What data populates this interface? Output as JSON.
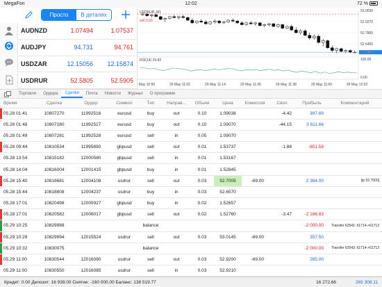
{
  "status": {
    "carrier": "MegaFon",
    "time": "12:02",
    "battery": "72 %"
  },
  "segment": {
    "simple": "Просто",
    "details": "В деталях"
  },
  "quotes": [
    {
      "symbol": "AUDNZD",
      "bid": "1.07494",
      "ask": "1.07537"
    },
    {
      "symbol": "AUDJPY",
      "bid": "94.731",
      "ask": "94.761"
    },
    {
      "symbol": "USDZAR",
      "bid": "12.15056",
      "ask": "12.15874"
    },
    {
      "symbol": "USDRUR",
      "bid": "52.5805",
      "ask": "52.5905"
    }
  ],
  "chart": {
    "title": "USDRUR, M1",
    "sell_label": "sell 0.03",
    "indicator_label": "RSI(14) 29.82",
    "y_ticks": [
      "53.0630",
      "52.9270",
      "52.7865",
      "52.6465",
      "52.5805",
      "52.5055"
    ],
    "rsi_ticks": [
      "100.00",
      "0.00"
    ],
    "x_ticks": [
      "29 May 10:50",
      "29 May 11:02",
      "29 May 11:14",
      "29 May 11:26",
      "29 May 11:38",
      "29 May 11:50",
      "29 May 12:02"
    ],
    "candles": [
      {
        "o": 53.0,
        "h": 53.03,
        "l": 52.99,
        "c": 53.01
      },
      {
        "o": 53.01,
        "h": 53.02,
        "l": 52.98,
        "c": 52.99
      },
      {
        "o": 52.99,
        "h": 53.01,
        "l": 52.97,
        "c": 53.0
      },
      {
        "o": 53.0,
        "h": 53.02,
        "l": 52.98,
        "c": 52.98
      },
      {
        "o": 52.98,
        "h": 52.99,
        "l": 52.94,
        "c": 52.95
      },
      {
        "o": 52.95,
        "h": 52.97,
        "l": 52.92,
        "c": 52.96
      },
      {
        "o": 52.96,
        "h": 52.99,
        "l": 52.95,
        "c": 52.98
      },
      {
        "o": 52.98,
        "h": 53.0,
        "l": 52.96,
        "c": 52.97
      },
      {
        "o": 52.97,
        "h": 52.99,
        "l": 52.95,
        "c": 52.98
      },
      {
        "o": 52.98,
        "h": 53.0,
        "l": 52.96,
        "c": 52.97
      },
      {
        "o": 52.97,
        "h": 52.98,
        "l": 52.93,
        "c": 52.94
      },
      {
        "o": 52.94,
        "h": 52.96,
        "l": 52.9,
        "c": 52.91
      },
      {
        "o": 52.91,
        "h": 52.94,
        "l": 52.9,
        "c": 52.93
      },
      {
        "o": 52.93,
        "h": 52.95,
        "l": 52.91,
        "c": 52.92
      },
      {
        "o": 52.92,
        "h": 52.94,
        "l": 52.89,
        "c": 52.9
      },
      {
        "o": 52.9,
        "h": 52.93,
        "l": 52.89,
        "c": 52.92
      },
      {
        "o": 52.92,
        "h": 52.95,
        "l": 52.9,
        "c": 52.93
      },
      {
        "o": 52.93,
        "h": 52.94,
        "l": 52.9,
        "c": 52.91
      },
      {
        "o": 52.91,
        "h": 52.93,
        "l": 52.9,
        "c": 52.92
      },
      {
        "o": 52.92,
        "h": 52.95,
        "l": 52.91,
        "c": 52.94
      },
      {
        "o": 52.94,
        "h": 52.96,
        "l": 52.92,
        "c": 52.93
      },
      {
        "o": 52.93,
        "h": 52.94,
        "l": 52.9,
        "c": 52.91
      },
      {
        "o": 52.91,
        "h": 52.93,
        "l": 52.88,
        "c": 52.89
      },
      {
        "o": 52.89,
        "h": 52.92,
        "l": 52.88,
        "c": 52.91
      },
      {
        "o": 52.91,
        "h": 52.93,
        "l": 52.89,
        "c": 52.9
      },
      {
        "o": 52.9,
        "h": 52.92,
        "l": 52.88,
        "c": 52.91
      },
      {
        "o": 52.91,
        "h": 52.92,
        "l": 52.87,
        "c": 52.88
      },
      {
        "o": 52.88,
        "h": 52.9,
        "l": 52.86,
        "c": 52.89
      },
      {
        "o": 52.89,
        "h": 52.91,
        "l": 52.87,
        "c": 52.9
      },
      {
        "o": 52.9,
        "h": 52.91,
        "l": 52.86,
        "c": 52.87
      },
      {
        "o": 52.87,
        "h": 52.9,
        "l": 52.86,
        "c": 52.89
      },
      {
        "o": 52.89,
        "h": 52.9,
        "l": 52.84,
        "c": 52.85
      },
      {
        "o": 52.85,
        "h": 52.88,
        "l": 52.84,
        "c": 52.87
      },
      {
        "o": 52.87,
        "h": 52.89,
        "l": 52.82,
        "c": 52.83
      },
      {
        "o": 52.83,
        "h": 52.86,
        "l": 52.79,
        "c": 52.8
      },
      {
        "o": 52.8,
        "h": 52.84,
        "l": 52.78,
        "c": 52.82
      },
      {
        "o": 52.82,
        "h": 52.84,
        "l": 52.76,
        "c": 52.77
      },
      {
        "o": 52.77,
        "h": 52.8,
        "l": 52.72,
        "c": 52.74
      },
      {
        "o": 52.74,
        "h": 52.78,
        "l": 52.72,
        "c": 52.76
      },
      {
        "o": 52.76,
        "h": 52.78,
        "l": 52.68,
        "c": 52.69
      },
      {
        "o": 52.69,
        "h": 52.73,
        "l": 52.65,
        "c": 52.71
      },
      {
        "o": 52.71,
        "h": 52.72,
        "l": 52.62,
        "c": 52.63
      },
      {
        "o": 52.63,
        "h": 52.66,
        "l": 52.58,
        "c": 52.6
      },
      {
        "o": 52.6,
        "h": 52.63,
        "l": 52.57,
        "c": 52.62
      },
      {
        "o": 52.62,
        "h": 52.63,
        "l": 52.58,
        "c": 52.59
      },
      {
        "o": 52.59,
        "h": 52.61,
        "l": 52.57,
        "c": 52.6
      },
      {
        "o": 52.6,
        "h": 52.61,
        "l": 52.57,
        "c": 52.58
      },
      {
        "o": 52.58,
        "h": 52.6,
        "l": 52.57,
        "c": 52.58
      }
    ],
    "rsi": [
      55,
      52,
      48,
      50,
      44,
      40,
      46,
      52,
      50,
      48,
      44,
      38,
      42,
      45,
      40,
      43,
      47,
      44,
      46,
      50,
      48,
      43,
      39,
      44,
      42,
      45,
      40,
      43,
      46,
      41,
      44,
      38,
      42,
      36,
      32,
      38,
      34,
      30,
      36,
      28,
      33,
      27,
      30,
      34,
      31,
      33,
      30,
      29
    ]
  },
  "tabs": [
    "Торговля",
    "Ордера",
    "Сделки",
    "Почта",
    "Новости",
    "Журнал",
    "О программе"
  ],
  "active_tab": "Сделки",
  "columns": [
    "Время",
    "Сделка",
    "Ордер",
    "Символ",
    "Тип",
    "Направ...",
    "Объем",
    "Цена",
    "Комиссия",
    "Своп",
    "Прибыль",
    "Комментарий"
  ],
  "rows": [
    {
      "time": "05.28 01:41",
      "deal": "10807270",
      "order": "11992516",
      "symbol": "eurusd",
      "type": "buy",
      "dir": "out",
      "vol": "0.10",
      "price": "1.09038",
      "comm": "",
      "swap": "-4.42",
      "profit": "397.89",
      "pc": "blue",
      "comment": "",
      "mark": "red"
    },
    {
      "time": "05.28 01:48",
      "deal": "10807280",
      "order": "11992527",
      "symbol": "eurusd",
      "type": "buy",
      "dir": "out",
      "vol": "0.10",
      "price": "1.09070",
      "comm": "",
      "swap": "-44.15",
      "profit": "3 811.66",
      "pc": "blue",
      "comment": "",
      "mark": ""
    },
    {
      "time": "05.28 01:49",
      "deal": "10807281",
      "order": "11992528",
      "symbol": "eurusd",
      "type": "sell",
      "dir": "in",
      "vol": "0.05",
      "price": "1.09070",
      "comm": "",
      "swap": "",
      "profit": "",
      "pc": "",
      "comment": "",
      "mark": ""
    },
    {
      "time": "05.28 09:44",
      "deal": "10810534",
      "order": "11995890",
      "symbol": "gbpusd",
      "type": "sell",
      "dir": "out",
      "vol": "0.01",
      "price": "1.53737",
      "comm": "",
      "swap": "-1.88",
      "profit": "-651.58",
      "pc": "red",
      "comment": "",
      "mark": "red"
    },
    {
      "time": "05.28 13:54",
      "deal": "10815182",
      "order": "12000580",
      "symbol": "gbpusd",
      "type": "sell",
      "dir": "in",
      "vol": "0.01",
      "price": "1.53167",
      "comm": "",
      "swap": "",
      "profit": "",
      "pc": "",
      "comment": "",
      "mark": ""
    },
    {
      "time": "05.28 14:04",
      "deal": "10816004",
      "order": "12001415",
      "symbol": "gbpusd",
      "type": "buy",
      "dir": "in",
      "vol": "0.01",
      "price": "1.52845",
      "comm": "",
      "swap": "",
      "profit": "",
      "pc": "",
      "comment": "",
      "mark": ""
    },
    {
      "time": "05.28 15:40",
      "deal": "10818681",
      "order": "12004108",
      "symbol": "usdrur",
      "type": "sell",
      "dir": "out",
      "vol": "0.03",
      "price": "52.7005",
      "comm": "-69.00",
      "swap": "",
      "profit": "2 364.00",
      "pc": "blue",
      "comment": "[tp 52.7000]",
      "mark": "red",
      "hl": true
    },
    {
      "time": "05.28 15:44",
      "deal": "10818808",
      "order": "12004237",
      "symbol": "usdrur",
      "type": "buy",
      "dir": "in",
      "vol": "0.03",
      "price": "52.6570",
      "comm": "",
      "swap": "",
      "profit": "",
      "pc": "",
      "comment": "",
      "mark": ""
    },
    {
      "time": "05.28 17:01",
      "deal": "10820498",
      "order": "12005927",
      "symbol": "gbpusd",
      "type": "buy",
      "dir": "in",
      "vol": "0.02",
      "price": "1.52657",
      "comm": "",
      "swap": "",
      "profit": "",
      "pc": "",
      "comment": "",
      "mark": ""
    },
    {
      "time": "05.28 17:01",
      "deal": "10820582",
      "order": "12006017",
      "symbol": "gbpusd",
      "type": "sell",
      "dir": "out",
      "vol": "0.02",
      "price": "1.52760",
      "comm": "",
      "swap": "-3.47",
      "profit": "-2 186.83",
      "pc": "red",
      "comment": "",
      "mark": "red"
    },
    {
      "time": "05.29 10:25",
      "deal": "10829988",
      "order": "",
      "symbol": "",
      "type": "balance",
      "dir": "",
      "vol": "",
      "price": "",
      "comm": "",
      "swap": "",
      "profit": "-2 000.00",
      "pc": "red",
      "comment": "Transfer 62541: 61714->61713",
      "mark": "green"
    },
    {
      "time": "05.29 10:29",
      "deal": "10829994",
      "order": "12015524",
      "symbol": "usdrur",
      "type": "sell",
      "dir": "out",
      "vol": "0.03",
      "price": "53.0145",
      "comm": "-69.00",
      "swap": "",
      "profit": "357.50",
      "pc": "blue",
      "comment": "",
      "mark": "red"
    },
    {
      "time": "05.29 10:32",
      "deal": "10830075",
      "order": "",
      "symbol": "",
      "type": "balance",
      "dir": "",
      "vol": "",
      "price": "",
      "comm": "",
      "swap": "",
      "profit": "-2 000.00",
      "pc": "red",
      "comment": "Transfer 62543: 61714->61713",
      "mark": "green"
    },
    {
      "time": "05.29 11:00",
      "deal": "10830544",
      "order": "12016080",
      "symbol": "usdrur",
      "type": "sell",
      "dir": "out",
      "vol": "0.03",
      "price": "52.9200",
      "comm": "-69.00",
      "swap": "",
      "profit": "265.00",
      "pc": "blue",
      "comment": "",
      "mark": "red"
    },
    {
      "time": "05.29 11:00",
      "deal": "10830550",
      "order": "12016085",
      "symbol": "usdrur",
      "type": "sell",
      "dir": "in",
      "vol": "0.03",
      "price": "52.9210",
      "comm": "",
      "swap": "",
      "profit": "",
      "pc": "",
      "comment": "",
      "mark": ""
    }
  ],
  "footer": {
    "balance": "Кредит: 0.00 Депозит: 16 939.00 Снятие: -160 000.00 Баланс: 138 519.77",
    "total1": "16 272.66",
    "total2": "265 308.11"
  }
}
